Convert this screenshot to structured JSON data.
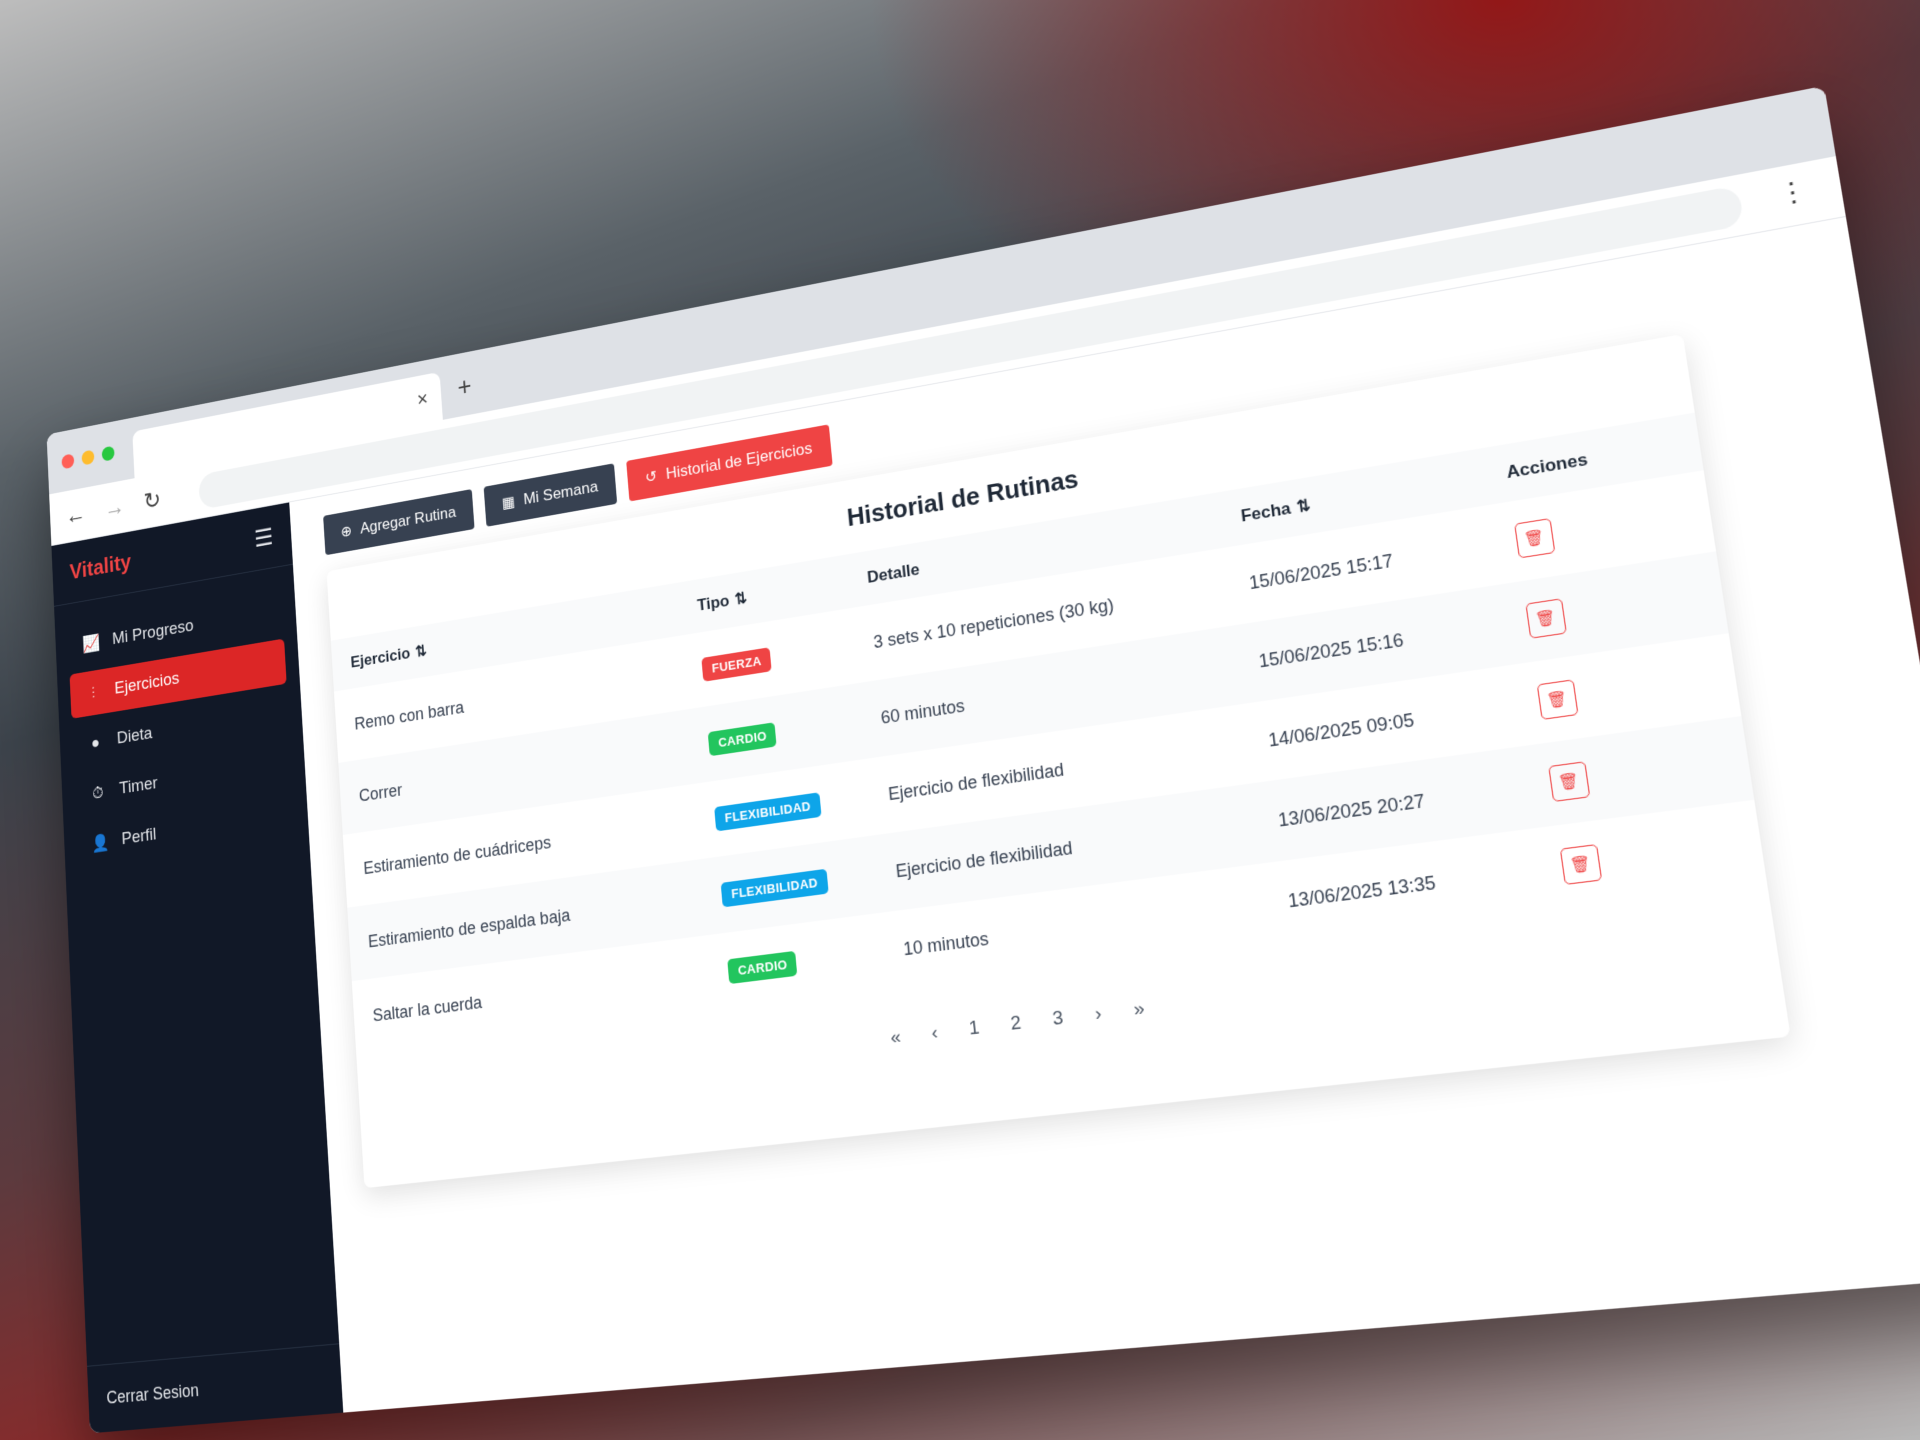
{
  "browser": {
    "tab_close": "×",
    "new_tab": "+",
    "back": "←",
    "forward": "→",
    "reload": "↻",
    "menu": "⋮"
  },
  "sidebar": {
    "brand": "Vitality",
    "menu_icon": "☰",
    "items": [
      {
        "label": "Mi Progreso",
        "icon": "chart-line-icon",
        "glyph": "📈",
        "active": false
      },
      {
        "label": "Ejercicios",
        "icon": "dumbbell-icon",
        "glyph": "⫶",
        "active": true
      },
      {
        "label": "Dieta",
        "icon": "apple-icon",
        "glyph": "●",
        "active": false
      },
      {
        "label": "Timer",
        "icon": "stopwatch-icon",
        "glyph": "⏱",
        "active": false
      },
      {
        "label": "Perfil",
        "icon": "user-icon",
        "glyph": "👤",
        "active": false
      }
    ],
    "logout": "Cerrar Sesion"
  },
  "toolbar": {
    "add_routine": "Agregar Rutina",
    "my_week": "Mi Semana",
    "history": "Historial de Ejercicios"
  },
  "colors": {
    "accent": "#ef4444",
    "sidebar_bg": "#111827",
    "fuerza": "#ef4444",
    "cardio": "#22c55e",
    "flexibilidad": "#0ea5e9"
  },
  "table": {
    "title": "Historial de Rutinas",
    "headers": {
      "exercise": "Ejercicio",
      "type": "Tipo",
      "detail": "Detalle",
      "date": "Fecha",
      "actions": "Acciones"
    },
    "sort_glyph": "⇅",
    "rows": [
      {
        "exercise": "Remo con barra",
        "type": "FUERZA",
        "type_color": "#ef4444",
        "detail": "3 sets x 10 repeticiones (30 kg)",
        "date": "15/06/2025 15:17"
      },
      {
        "exercise": "Correr",
        "type": "CARDIO",
        "type_color": "#22c55e",
        "detail": "60 minutos",
        "date": "15/06/2025 15:16"
      },
      {
        "exercise": "Estiramiento de cuádriceps",
        "type": "FLEXIBILIDAD",
        "type_color": "#0ea5e9",
        "detail": "Ejercicio de flexibilidad",
        "date": "14/06/2025 09:05"
      },
      {
        "exercise": "Estiramiento de espalda baja",
        "type": "FLEXIBILIDAD",
        "type_color": "#0ea5e9",
        "detail": "Ejercicio de flexibilidad",
        "date": "13/06/2025 20:27"
      },
      {
        "exercise": "Saltar la cuerda",
        "type": "CARDIO",
        "type_color": "#22c55e",
        "detail": "10 minutos",
        "date": "13/06/2025 13:35"
      }
    ]
  },
  "pagination": {
    "first": "«",
    "prev": "‹",
    "pages": [
      "1",
      "2",
      "3"
    ],
    "next": "›",
    "last": "»"
  }
}
